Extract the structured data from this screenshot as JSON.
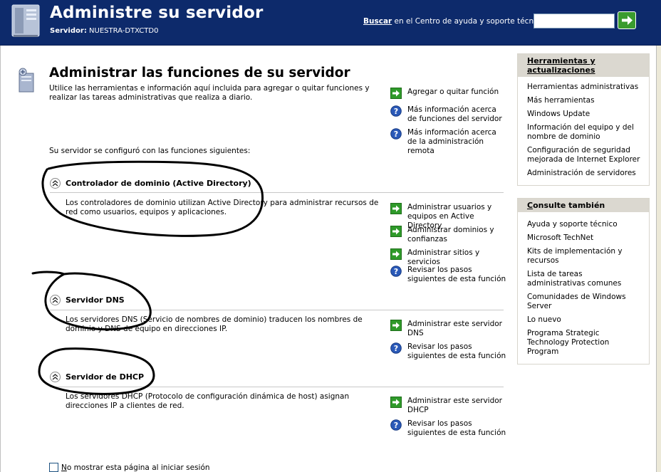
{
  "header": {
    "title": "Administre su servidor",
    "server_label": "Servidor:",
    "server_name": "NUESTRA-DTXCTD0",
    "search_label_bold": "Buscar",
    "search_label_rest": " en el Centro de ayuda y soporte técnico",
    "search_value": "",
    "go_icon": "green-arrow-go-icon"
  },
  "main": {
    "title": "Administrar las funciones de su servidor",
    "description": "Utilice las herramientas e información aquí incluida para agregar o quitar funciones y realizar las tareas administrativas que realiza a diario.",
    "config_line": "Su servidor se configuró con las funciones siguientes:",
    "actions": [
      {
        "icon": "green-arrow-icon",
        "label": "Agregar o quitar función"
      },
      {
        "icon": "help-icon",
        "label": "Más información acerca de funciones del servidor"
      },
      {
        "icon": "help-icon",
        "label": "Más información acerca de la administración remota"
      }
    ]
  },
  "roles": [
    {
      "name": "Controlador de dominio (Active Directory)",
      "description": "Los controladores de dominio utilizan Active Directory para administrar recursos de red como usuarios, equipos y aplicaciones.",
      "actions": [
        {
          "icon": "green-arrow-icon",
          "label": "Administrar usuarios y equipos en Active Directory"
        },
        {
          "icon": "green-arrow-icon",
          "label": "Administrar dominios y confianzas"
        },
        {
          "icon": "green-arrow-icon",
          "label": "Administrar sitios y servicios"
        },
        {
          "icon": "help-icon",
          "label": "Revisar los pasos siguientes de esta función"
        }
      ]
    },
    {
      "name": "Servidor DNS",
      "description": "Los servidores DNS (Servicio de nombres de dominio) traducen los nombres de dominio y DNS de equipo en direcciones IP.",
      "actions": [
        {
          "icon": "green-arrow-icon",
          "label": "Administrar este servidor DNS"
        },
        {
          "icon": "help-icon",
          "label": "Revisar los pasos siguientes de esta función"
        }
      ]
    },
    {
      "name": "Servidor de DHCP",
      "description": "Los servidores DHCP (Protocolo de configuración dinámica de host) asignan direcciones IP a clientes de red.",
      "actions": [
        {
          "icon": "green-arrow-icon",
          "label": "Administrar este servidor DHCP"
        },
        {
          "icon": "help-icon",
          "label": "Revisar los pasos siguientes de esta función"
        }
      ]
    }
  ],
  "tools_panel": {
    "title": "Herramientas y actualizaciones",
    "items": [
      "Herramientas administrativas",
      "Más herramientas",
      "Windows Update",
      "Información del equipo y del nombre de dominio",
      "Configuración de seguridad mejorada de Internet Explorer",
      "Administración de servidores"
    ]
  },
  "see_also_panel": {
    "title_underlined": "C",
    "title_rest": "onsulte también",
    "items": [
      "Ayuda y soporte técnico",
      "Microsoft TechNet",
      "Kits de implementación y recursos",
      "Lista de tareas administrativas comunes",
      "Comunidades de Windows Server",
      "Lo nuevo",
      "Programa Strategic Technology Protection Program"
    ]
  },
  "footer": {
    "checkbox_checked": false,
    "label_underlined": "N",
    "label_rest": "o mostrar esta página al iniciar sesión"
  },
  "colors": {
    "header_bg": "#0d2a6b",
    "panel_head_bg": "#dbd8d0",
    "go_button": "#3a9b2e",
    "annotation_ink": "#000000"
  }
}
